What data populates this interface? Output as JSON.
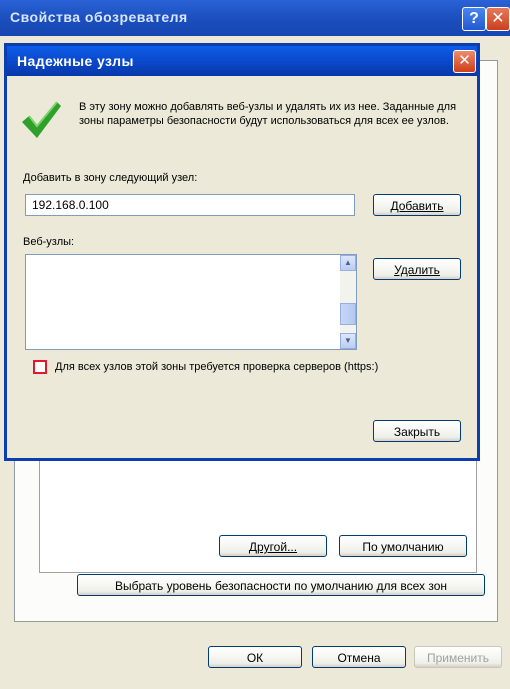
{
  "back_window": {
    "title": "Свойства обозревателя",
    "help_glyph": "?",
    "close_glyph": "✕",
    "buttons": {
      "custom_level": "Другой...",
      "default_level": "По умолчанию",
      "reset_all_zones": "Выбрать уровень безопасности по умолчанию для всех зон",
      "ok": "ОК",
      "cancel": "Отмена",
      "apply": "Применить"
    }
  },
  "dialog": {
    "title": "Надежные узлы",
    "close_glyph": "✕",
    "description": "В эту зону можно добавлять веб-узлы и удалять их из нее. Заданные для зоны параметры безопасности будут использоваться для всех ее узлов.",
    "add_label": "Добавить в зону следующий узел:",
    "add_input_value": "192.168.0.100",
    "add_button": "Добавить",
    "sites_label": "Веб-узлы:",
    "sites": [],
    "remove_button": "Удалить",
    "https_checkbox_label": "Для всех узлов этой зоны требуется проверка серверов (https:)",
    "https_checked": false,
    "close_button": "Закрыть"
  },
  "colors": {
    "titlebar": "#0a49cc",
    "highlight_border": "#e3192a",
    "check_icon": "#2fa12a"
  }
}
